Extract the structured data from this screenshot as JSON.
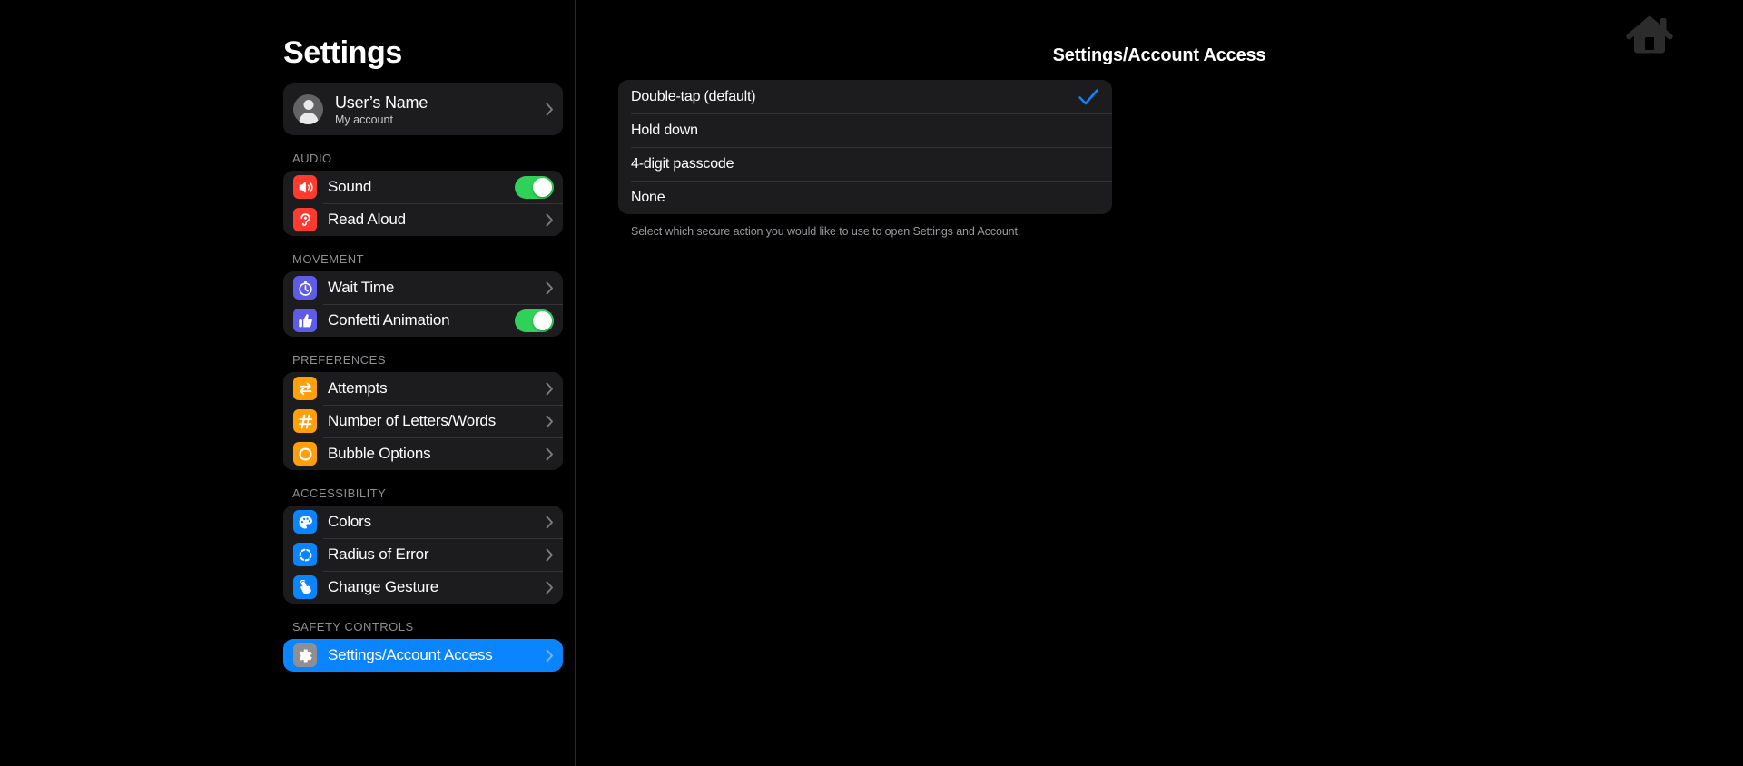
{
  "sidebar": {
    "title": "Settings",
    "account": {
      "name": "User’s Name",
      "subtitle": "My account",
      "avatar_icon": "person-avatar-icon",
      "chevron_icon": "chevron-right-icon"
    },
    "groups": [
      {
        "header": "AUDIO",
        "items": [
          {
            "label": "Sound",
            "icon": "speaker-wave-icon",
            "icon_color": "#ff3b30",
            "control": "toggle",
            "toggle_on": true
          },
          {
            "label": "Read Aloud",
            "icon": "ear-icon",
            "icon_color": "#ff3b30",
            "control": "chevron"
          }
        ]
      },
      {
        "header": "MOVEMENT",
        "items": [
          {
            "label": "Wait Time",
            "icon": "stopwatch-icon",
            "icon_color": "#5e5ce6",
            "control": "chevron"
          },
          {
            "label": "Confetti Animation",
            "icon": "thumbs-up-icon",
            "icon_color": "#5e5ce6",
            "control": "toggle",
            "toggle_on": true
          }
        ]
      },
      {
        "header": "PREFERENCES",
        "items": [
          {
            "label": "Attempts",
            "icon": "repeat-arrows-icon",
            "icon_color": "#ff9f0a",
            "control": "chevron"
          },
          {
            "label": "Number of Letters/Words",
            "icon": "hash-icon",
            "icon_color": "#ff9f0a",
            "control": "chevron"
          },
          {
            "label": "Bubble Options",
            "icon": "circle-outline-icon",
            "icon_color": "#ff9f0a",
            "control": "chevron"
          }
        ]
      },
      {
        "header": "ACCESSIBILITY",
        "items": [
          {
            "label": "Colors",
            "icon": "palette-icon",
            "icon_color": "#0a84ff",
            "control": "chevron"
          },
          {
            "label": "Radius of Error",
            "icon": "dashed-circle-icon",
            "icon_color": "#0a84ff",
            "control": "chevron"
          },
          {
            "label": "Change Gesture",
            "icon": "hand-tap-icon",
            "icon_color": "#0a84ff",
            "control": "chevron"
          }
        ]
      },
      {
        "header": "SAFETY CONTROLS",
        "accent": true,
        "accent_color": "#0a84ff",
        "items": [
          {
            "label": "Settings/Account Access",
            "icon": "gear-icon",
            "icon_color": "#8e8e93",
            "control": "chevron"
          }
        ]
      }
    ]
  },
  "detail": {
    "title": "Settings/Account Access",
    "home_icon": "home-icon",
    "options": [
      {
        "label": "Double-tap (default)",
        "selected": true
      },
      {
        "label": "Hold down",
        "selected": false
      },
      {
        "label": "4-digit passcode",
        "selected": false
      },
      {
        "label": "None",
        "selected": false
      }
    ],
    "footer": "Select which secure action you would like to use to open Settings and Account.",
    "check_icon": "checkmark-icon",
    "accent_color": "#0a84ff"
  }
}
